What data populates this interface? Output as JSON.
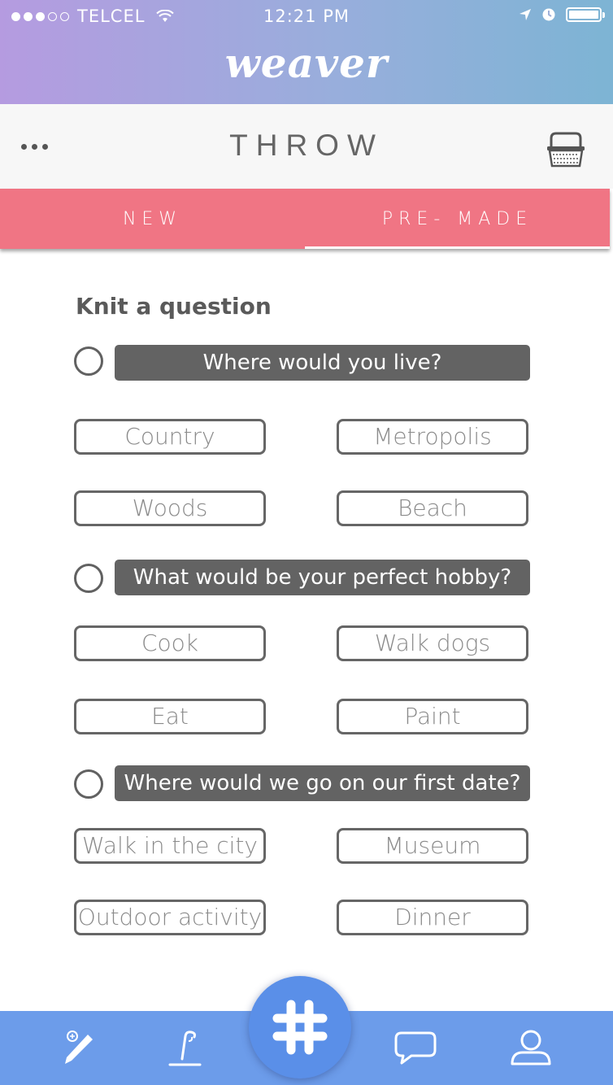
{
  "status_bar": {
    "carrier": "TELCEL",
    "time": "12:21 PM",
    "battery_percent": 100
  },
  "header": {
    "logo": "weaver",
    "title": "THROW",
    "more_icon": "ellipsis-icon",
    "basket_icon": "basket-icon"
  },
  "tabs": [
    {
      "label": "NEW",
      "active": false
    },
    {
      "label": "PRE- MADE",
      "active": true
    }
  ],
  "section_title": "Knit a question",
  "questions": [
    {
      "text": "Where would you live?",
      "options": [
        "Country",
        "Metropolis",
        "Woods",
        "Beach"
      ]
    },
    {
      "text": "What would be your perfect hobby?",
      "options": [
        "Cook",
        "Walk dogs",
        "Eat",
        "Paint"
      ]
    },
    {
      "text": "Where would we go on our first date?",
      "options": [
        "Walk in the city",
        "Museum",
        "Outdoor activity",
        "Dinner"
      ]
    }
  ],
  "bottom_nav": [
    {
      "icon": "pencil-icon"
    },
    {
      "icon": "crochet-hook-icon"
    },
    {
      "icon": "hashtag-icon"
    },
    {
      "icon": "chat-bubble-icon"
    },
    {
      "icon": "profile-icon"
    }
  ],
  "colors": {
    "header_gradient_start": "#b59be0",
    "header_gradient_end": "#7db4d4",
    "tab_bar": "#f07584",
    "question_bar": "#636363",
    "bottom_nav": "#6c9cea",
    "fab": "#5a8fe8"
  }
}
